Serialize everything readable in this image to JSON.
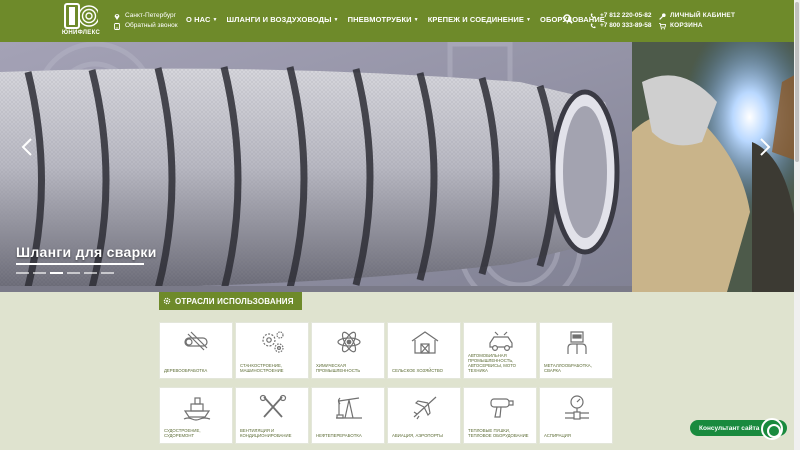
{
  "brand": {
    "name": "ЮНИФЛЕКС",
    "color": "#6e8a2a"
  },
  "contacts": {
    "city": "Санкт-Петербург",
    "callback": "Обратный звонок"
  },
  "nav": [
    {
      "label": "О НАС",
      "dropdown": true
    },
    {
      "label": "ШЛАНГИ И ВОЗДУХОВОДЫ",
      "dropdown": true
    },
    {
      "label": "ПНЕВМОТРУБКИ",
      "dropdown": true
    },
    {
      "label": "КРЕПЕЖ И СОЕДИНЕНИЕ",
      "dropdown": true
    },
    {
      "label": "ОБОРУДОВАНИЕ",
      "dropdown": false
    }
  ],
  "phones": [
    "+7 812 220-05-82",
    "+7 800 333-89-58"
  ],
  "account": {
    "cabinet": "ЛИЧНЫЙ КАБИНЕТ",
    "cart": "КОРЗИНА"
  },
  "hero": {
    "slide_title": "Шланги для сварки",
    "slides_count": 6,
    "active_slide": 3
  },
  "industries": {
    "title": "ОТРАСЛИ ИСПОЛЬЗОВАНИЯ",
    "items": [
      {
        "label": "ДЕРЕВООБРАБОТКА",
        "icon": "sawmill-icon"
      },
      {
        "label": "СТАНКОСТРОЕНИЕ, МАШИНОСТРОЕНИЕ",
        "icon": "gears-icon"
      },
      {
        "label": "ХИМИЧЕСКАЯ ПРОМЫШЛЕННОСТЬ",
        "icon": "atom-icon"
      },
      {
        "label": "СЕЛЬСКОЕ ХОЗЯЙСТВО",
        "icon": "barn-icon"
      },
      {
        "label": "АВТОМОБИЛЬНАЯ ПРОМЫШЛЕННОСТЬ, АВТОСЕРВИСЫ, МОТО ТЕХНИКА",
        "icon": "car-icon"
      },
      {
        "label": "МЕТАЛЛООБРАБОТКА, СВАРКА",
        "icon": "welder-icon"
      },
      {
        "label": "СУДОСТРОЕНИЕ, СУДОРЕМОНТ",
        "icon": "ship-icon"
      },
      {
        "label": "ВЕНТИЛЯЦИЯ И КОНДИЦИОНИРОВАНИЕ",
        "icon": "tools-icon"
      },
      {
        "label": "НЕФТЕПЕРЕРАБОТКА",
        "icon": "oil-pump-icon"
      },
      {
        "label": "АВИАЦИЯ, АЭРОПОРТЫ",
        "icon": "airplane-icon"
      },
      {
        "label": "ТЕПЛОВЫЕ ПУШКИ, ТЕПЛОВОЕ ОБОРУДОВАНИЕ",
        "icon": "heat-gun-icon"
      },
      {
        "label": "АСПИРАЦИЯ",
        "icon": "gauge-icon"
      }
    ]
  },
  "consultant": {
    "label": "Консультант сайта",
    "color": "#198a3e"
  }
}
